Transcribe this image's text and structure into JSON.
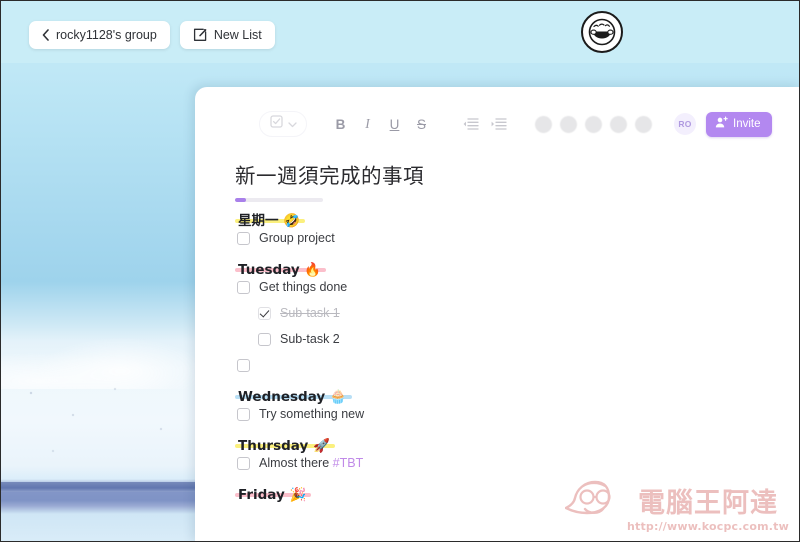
{
  "topbar": {
    "back_button": {
      "label": "rocky1128's group",
      "icon": "chevron-left-icon"
    },
    "new_list_button": {
      "label": "New List",
      "icon": "compose-icon"
    },
    "avatar": {
      "icon": "sheep-avatar-icon"
    }
  },
  "toolbar": {
    "checkbox_dropdown": {
      "icon": "checkbox-icon",
      "chevron": "chevron-down-icon"
    },
    "bold_label": "B",
    "italic_label": "I",
    "underline_label": "U",
    "strikethrough_label": "S",
    "outdent_icon": "outdent-icon",
    "indent_icon": "indent-icon",
    "swatch_count": 5,
    "swatch_color": "#e6e6e8",
    "member_avatar_initials": "RO",
    "invite_label": "Invite",
    "invite_icon": "add-person-icon",
    "invite_color": "#b388f0"
  },
  "document": {
    "title": "新一週須完成的事項",
    "progress_percent": 13,
    "progress_color": "#a980ea",
    "sections": [
      {
        "day_label": "星期一",
        "emoji": "🤣",
        "highlight": "#fbf07e",
        "tasks": [
          {
            "label": "Group project",
            "checked": false,
            "sub": false
          }
        ]
      },
      {
        "day_label": "Tuesday",
        "emoji": "🔥",
        "highlight": "#fbbfcb",
        "tasks": [
          {
            "label": "Get things done",
            "checked": false,
            "sub": false
          },
          {
            "label": "Sub-task 1",
            "checked": true,
            "sub": true
          },
          {
            "label": "Sub-task 2",
            "checked": false,
            "sub": true
          },
          {
            "label": "",
            "checked": false,
            "sub": false
          }
        ]
      },
      {
        "day_label": "Wednesday",
        "emoji": "🧁",
        "highlight": "#b8dff5",
        "tasks": [
          {
            "label": "Try something new",
            "checked": false,
            "sub": false
          }
        ]
      },
      {
        "day_label": "Thursday",
        "emoji": "🚀",
        "highlight": "#fbf07e",
        "tasks": [
          {
            "label": "Almost there ",
            "tag": "#TBT",
            "checked": false,
            "sub": false
          }
        ]
      },
      {
        "day_label": "Friday",
        "emoji": "🎉",
        "highlight": "#fbbfcb",
        "tasks": []
      }
    ]
  },
  "watermark": {
    "brand": "電腦王阿達",
    "url": "http://www.kocpc.com.tw",
    "color": "#c1302a"
  }
}
